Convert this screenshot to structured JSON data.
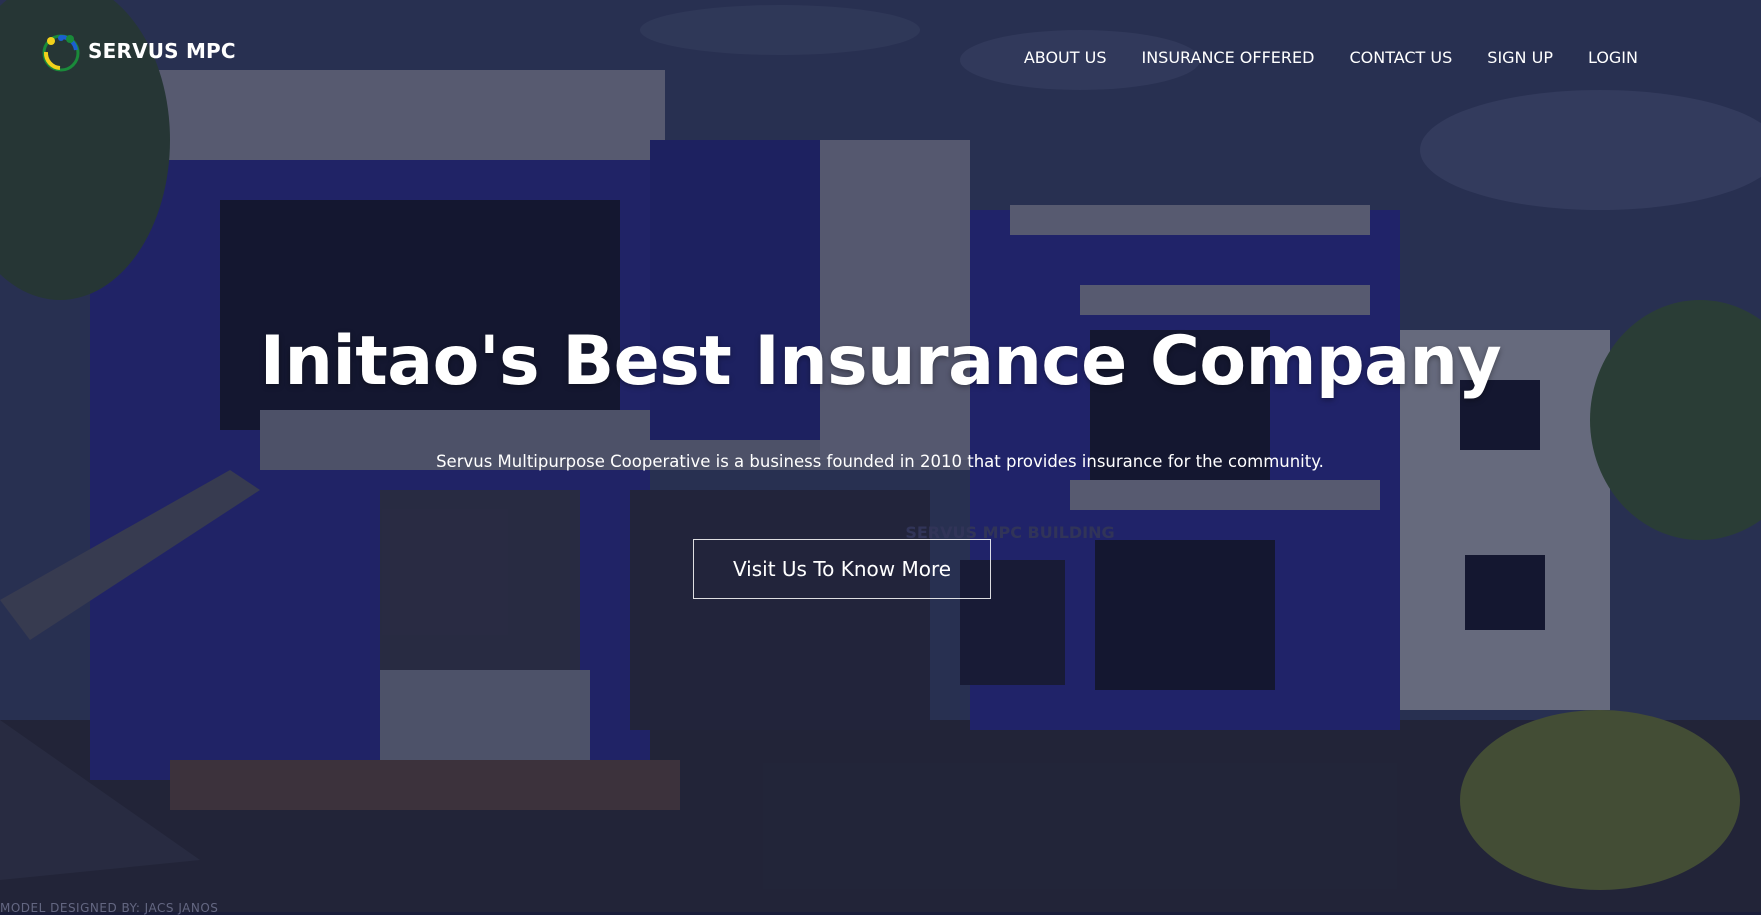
{
  "brand": {
    "name": "SERVUS MPC",
    "logo_icon": "people-circle-logo-icon"
  },
  "nav": {
    "about": "ABOUT US",
    "insurance": "INSURANCE OFFERED",
    "contact": "CONTACT US",
    "signup": "SIGN UP",
    "login": "LOGIN"
  },
  "hero": {
    "title": "Initao's Best Insurance Company",
    "subtitle": "Servus Multipurpose Cooperative is a business founded in 2010 that provides insurance for the community.",
    "cta_label": "Visit Us To Know More",
    "building_sign": "SERVUS MPC BUILDING"
  },
  "footer": {
    "credit": "MODEL DESIGNED BY: JACS JANOS"
  },
  "colors": {
    "overlay": "#14162d",
    "building_blue": "#2b2fa0",
    "sky": "#3b4a78",
    "text": "#ffffff"
  }
}
